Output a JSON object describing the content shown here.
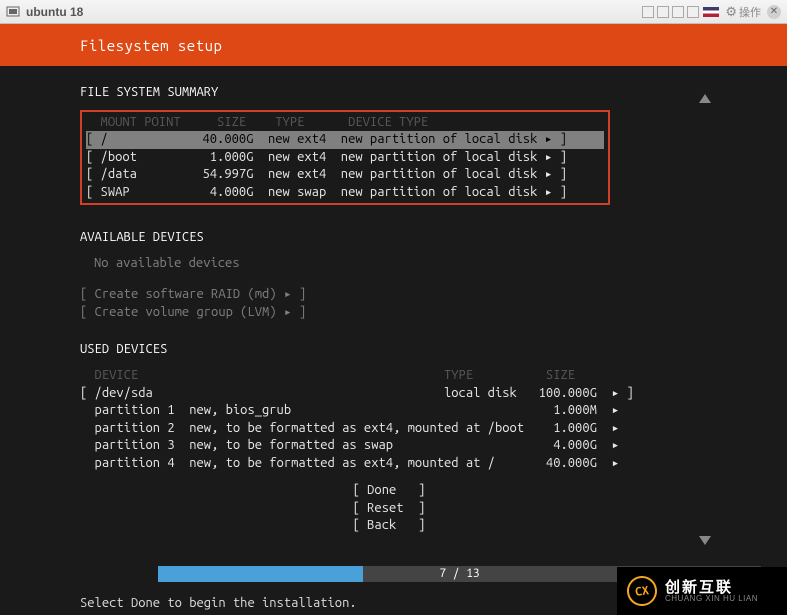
{
  "window": {
    "title": "ubuntu 18",
    "action_label": "操作"
  },
  "header": {
    "title": "Filesystem setup"
  },
  "fs_summary": {
    "title": "FILE SYSTEM SUMMARY",
    "header": "  MOUNT POINT     SIZE    TYPE      DEVICE TYPE",
    "rows": [
      {
        "line": "[ /             40.000G  new ext4  new partition of local disk ▸ ]",
        "selected": true
      },
      {
        "line": "[ /boot          1.000G  new ext4  new partition of local disk ▸ ]",
        "selected": false
      },
      {
        "line": "[ /data         54.997G  new ext4  new partition of local disk ▸ ]",
        "selected": false
      },
      {
        "line": "[ SWAP           4.000G  new swap  new partition of local disk ▸ ]",
        "selected": false
      }
    ]
  },
  "available": {
    "title": "AVAILABLE DEVICES",
    "none_text": "No available devices",
    "options": [
      "[ Create software RAID (md) ▸ ]",
      "[ Create volume group (LVM) ▸ ]"
    ]
  },
  "used": {
    "title": "USED DEVICES",
    "header": "  DEVICE                                          TYPE          SIZE",
    "rows": [
      "[ /dev/sda                                        local disk   100.000G  ▸ ]",
      "  partition 1  new, bios_grub                                    1.000M  ▸",
      "  partition 2  new, to be formatted as ext4, mounted at /boot    1.000G  ▸",
      "  partition 3  new, to be formatted as swap                      4.000G  ▸",
      "  partition 4  new, to be formatted as ext4, mounted at /       40.000G  ▸"
    ]
  },
  "buttons": {
    "done": "[ Done   ]",
    "reset": "[ Reset  ]",
    "back": "[ Back   ]"
  },
  "progress": {
    "current": 7,
    "total": 13,
    "text": "7 / 13",
    "percent": 34
  },
  "hint": "Select Done to begin the installation.",
  "watermark": {
    "cn": "创新互联",
    "en": "CHUANG XIN HU LIAN"
  }
}
